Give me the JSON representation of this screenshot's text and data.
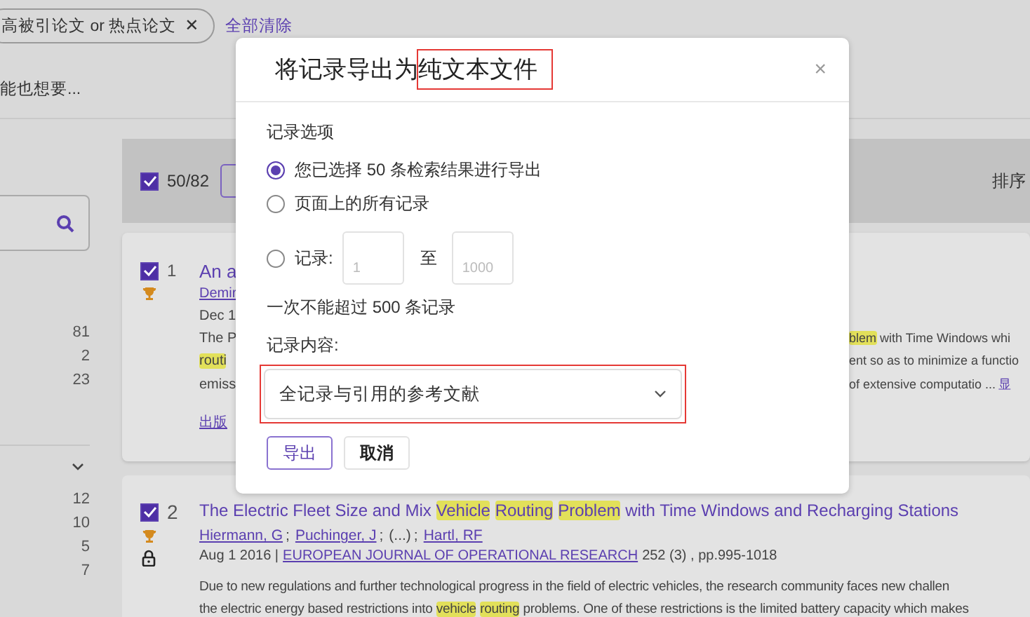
{
  "filter_chip": {
    "label": "高被引论文 or 热点论文",
    "remove": "✕"
  },
  "clear_all": "全部清除",
  "suggestion": "能也想要...",
  "sidebar": {
    "groups": [
      {
        "counts": [
          "81",
          "2",
          "23"
        ]
      },
      {
        "expanded": false,
        "counts": [
          "12",
          "10",
          "5",
          "7"
        ]
      }
    ]
  },
  "toolbar": {
    "select_all": {
      "checked": true
    },
    "selected_count": "50/82",
    "sort_label": "排序"
  },
  "results": [
    {
      "number": "1",
      "checked": true,
      "lines": [
        {
          "kind": "title",
          "left": [
            {
              "text": "An a",
              "highlight": false
            }
          ]
        },
        {
          "kind": "authors",
          "left": [
            {
              "text": "Demir",
              "highlight": false
            }
          ]
        },
        {
          "kind": "meta",
          "left": [
            {
              "text": "Dec 1",
              "highlight": false
            }
          ]
        },
        {
          "kind": "abstract",
          "left": [
            {
              "text": "The P",
              "highlight": false
            }
          ],
          "right": [
            {
              "text": "blem",
              "highlight": true
            },
            {
              "text": " with Time Windows whi",
              "highlight": false
            }
          ]
        },
        {
          "kind": "abstract",
          "left": [
            {
              "text": "routi",
              "highlight": true
            }
          ],
          "right": [
            {
              "text": "ent so as to minimize a functio",
              "highlight": false
            }
          ]
        },
        {
          "kind": "abstract",
          "left": [
            {
              "text": "emiss",
              "highlight": false
            }
          ],
          "right": [
            {
              "text": "of extensive computatio ... ",
              "highlight": false
            },
            {
              "text": "显",
              "highlight": false,
              "link": true
            }
          ]
        },
        {
          "kind": "link",
          "left": [
            {
              "text": "出版",
              "highlight": false
            }
          ]
        }
      ]
    },
    {
      "number": "2",
      "checked": true,
      "locked": true,
      "title": [
        {
          "text": "The Electric Fleet Size and Mix",
          "highlight": false
        },
        {
          "text": "Vehicle",
          "highlight": true
        },
        {
          "text": "Routing",
          "highlight": true
        },
        {
          "text": "Problem",
          "highlight": true
        },
        {
          "text": "with Time Windows and Recharging Stations",
          "highlight": false
        }
      ],
      "authors": [
        {
          "kind": "link",
          "name": "Hiermann, G",
          "sep": ";"
        },
        {
          "kind": "link",
          "name": "Puchinger, J",
          "sep": ";"
        },
        {
          "kind": "more",
          "name": "(...)",
          "sep": ";"
        },
        {
          "kind": "link",
          "name": "Hartl, RF"
        }
      ],
      "date": "Aug 1 2016 |",
      "journal": "EUROPEAN JOURNAL OF OPERATIONAL RESEARCH",
      "source": "252 (3) , pp.995-1018",
      "abstract": [
        [
          {
            "text": "Due to new regulations and further technological progress in the field of electric vehicles, the research community faces new challen",
            "highlight": false
          }
        ],
        [
          {
            "text": "the electric energy based restrictions into",
            "highlight": false
          },
          {
            "text": "vehicle",
            "highlight": true
          },
          {
            "text": "routing",
            "highlight": true
          },
          {
            "text": "problems. One of these restrictions is the limited battery capacity which makes",
            "highlight": false
          }
        ]
      ]
    }
  ],
  "dialog": {
    "title": "将记录导出为",
    "title_marked": "纯文本文件",
    "close": "×",
    "options_label": "记录选项",
    "options": [
      {
        "kind": "plain",
        "label": "您已选择 50 条检索结果进行导出",
        "selected": true
      },
      {
        "kind": "plain",
        "label": "页面上的所有记录",
        "selected": false
      },
      {
        "kind": "range",
        "label": "记录:",
        "selected": false,
        "from_placeholder": "1",
        "to_label": "至",
        "to_placeholder": "1000"
      }
    ],
    "limit_note": "一次不能超过 500 条记录",
    "content_label": "记录内容:",
    "content_value": "全记录与引用的参考文献",
    "content_marked": true,
    "buttons": [
      {
        "kind": "primary",
        "label": "导出"
      },
      {
        "kind": "secondary",
        "label": "取消"
      }
    ]
  }
}
